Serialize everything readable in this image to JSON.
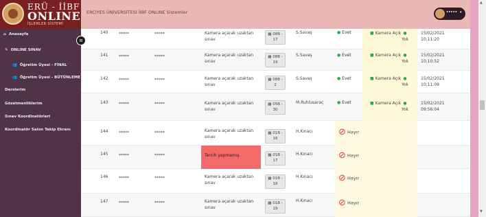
{
  "logo": {
    "line1": "ERÜ - İİBF",
    "line2": "ONLINE",
    "line3": "İŞLEMLER SİSTEMİ"
  },
  "sidebar": {
    "items": [
      {
        "label": "Anasayfa",
        "icon": "home-icon"
      },
      {
        "label": "ONLINE SINAV",
        "icon": "pencil-icon"
      },
      {
        "label": "Öğretim Üyesi - FİNAL",
        "icon": "users-icon"
      },
      {
        "label": "Öğretim Üyesi - BÜTÜNLEME",
        "icon": "users-icon"
      },
      {
        "label": "Derslerim"
      },
      {
        "label": "Gözetmenliklerim"
      },
      {
        "label": "Sınav Koordinatörleri"
      },
      {
        "label": "Koordinatör Salon Takip Ekranı"
      }
    ]
  },
  "header": {
    "system_title": "ERCİYES ÜNİVERSİTESİ İİBF ONLINE Sistemler",
    "user_name": "•••••"
  },
  "table": {
    "rows": [
      {
        "id": "140",
        "m1": "*****",
        "m2": "*****",
        "desc": "Kamera açarak uzaktan sınav",
        "room_a": "08B -",
        "room_b": "17",
        "person": "S.Savaş",
        "attend": "Evet",
        "camera": "Kamera Açık",
        "yok": "Yok",
        "date": "15/02/2021",
        "time": "10:11:20"
      },
      {
        "id": "141",
        "m1": "*****",
        "m2": "*****",
        "desc": "Kamera açarak uzaktan sınav",
        "room_a": "08B -",
        "room_b": "19",
        "person": "S.Savaş",
        "attend": "Evet",
        "camera": "Kamera Açık",
        "yok": "Yok",
        "date": "15/02/2021",
        "time": "10:10:52"
      },
      {
        "id": "142",
        "m1": "*****",
        "m2": "*****",
        "desc": "Kamera açarak uzaktan sınav",
        "room_a": "08B -",
        "room_b": "2",
        "person": "S.Savaş",
        "attend": "Evet",
        "camera": "Kamera Açık",
        "yok": "Yok",
        "date": "15/02/2021",
        "time": "10:11:09"
      },
      {
        "id": "143",
        "m1": "*****",
        "m2": "*****",
        "desc": "Kamera açarak uzaktan sınav",
        "room_a": "05B -",
        "room_b": "30",
        "person": "M.Ruhlusaraç",
        "attend": "Evet",
        "camera": "Kamera Açık",
        "yok": "Yok",
        "date": "15/02/2021",
        "time": "09:56:04"
      },
      {
        "id": "144",
        "m1": "*****",
        "m2": "*****",
        "desc": "Kamera açarak uzaktan sınav",
        "room_a": "01B -",
        "room_b": "16",
        "person": "H.Kınacı",
        "attend": "Hayır"
      },
      {
        "id": "145",
        "m1": "*****",
        "m2": "*****",
        "desc": "Tercih yapmamış",
        "room_a": "01B -",
        "room_b": "17",
        "person": "H.Kınacı",
        "attend": "Hayır"
      },
      {
        "id": "146",
        "m1": "*****",
        "m2": "*****",
        "desc": "Kamera açarak uzaktan sınav",
        "room_a": "01B -",
        "room_b": "18",
        "person": "H.Kınacı",
        "attend": "Hayır"
      },
      {
        "id": "147",
        "m1": "*****",
        "m2": "*****",
        "desc": "Kamera açarak uzaktan sınav",
        "room_a": "01B -",
        "room_b": "19",
        "person": "H.Kınacı",
        "attend": "Hayır"
      }
    ]
  },
  "colors": {
    "sidebar": "#4f3447",
    "topbar": "#eab9b5",
    "logo_bg": "#7a1f1f",
    "tercih": "#f26a6a",
    "yes_green": "#2fa84f",
    "no_red": "#e23a3a"
  }
}
